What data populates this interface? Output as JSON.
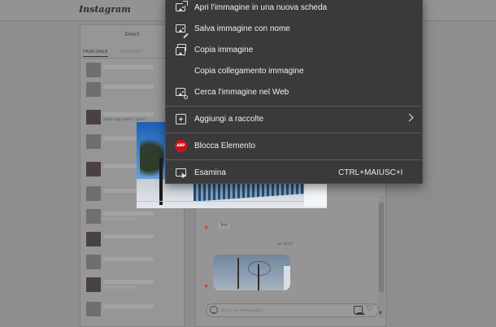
{
  "app": {
    "logo": "Instagram"
  },
  "sidebar": {
    "title": "Direct",
    "tabs": [
      {
        "label": "PRINCIPALE",
        "active": true
      },
      {
        "label": "GENERALE",
        "active": false
      }
    ],
    "conversation_preview_text": "attiva negli ultimi 2 giorni"
  },
  "chat": {
    "message_text": "Test",
    "timestamp": "ieri 18:41",
    "composer_placeholder": "Scrivi un messaggio..."
  },
  "context_menu": {
    "items": [
      {
        "label": "Apri l'immagine in una nuova scheda",
        "icon": "open-image-new-tab-icon"
      },
      {
        "label": "Salva immagine con nome",
        "icon": "save-image-icon"
      },
      {
        "label": "Copia immagine",
        "icon": "copy-image-icon"
      },
      {
        "label": "Copia collegamento immagine",
        "icon": ""
      },
      {
        "label": "Cerca l'immagine nel Web",
        "icon": "search-image-icon"
      },
      {
        "label": "Aggiungi a raccolte",
        "icon": "collections-icon",
        "submenu": true
      },
      {
        "label": "Blocca Elemento",
        "icon": "adblock-plus-icon",
        "badge": "ABP"
      },
      {
        "label": "Esamina",
        "icon": "inspect-icon",
        "shortcut": "CTRL+MAIUSC+I"
      }
    ]
  },
  "colors": {
    "menu_background": "#3a3a3a",
    "menu_text": "#f0f0f0",
    "abp_red": "#c8141c"
  }
}
